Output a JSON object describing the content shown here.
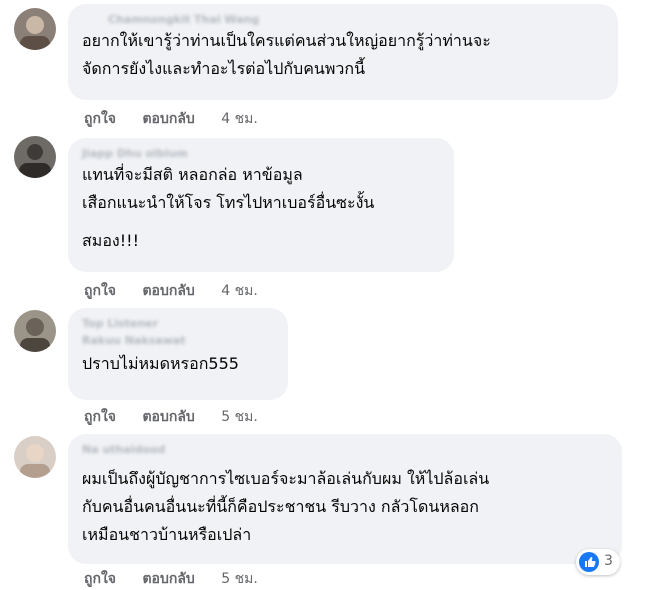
{
  "colors": {
    "bubble": "#f0f2f5",
    "text": "#050505",
    "meta": "#65676b",
    "like_blue": "#1877f2"
  },
  "comments": [
    {
      "author": "Chamnongkit Thai Wang",
      "text_lines": [
        "อยากให้เขารู้ว่าท่านเป็นใครแต่คนส่วนใหญ่อยากรู้ว่าท่านจะ",
        "จัดการยังไงและทำอะไรต่อไปกับคนพวกนี้"
      ],
      "like_label": "ถูกใจ",
      "reply_label": "ตอบกลับ",
      "time": "4 ชม."
    },
    {
      "author": "Jiapp Dhu olblum",
      "text_lines": [
        "แทนที่จะมีสติ หลอกล่อ หาข้อมูล",
        "เสือกแนะนำให้โจร โทรไปหาเบอร์อื่นซะงั้น",
        "สมอง!!!"
      ],
      "like_label": "ถูกใจ",
      "reply_label": "ตอบกลับ",
      "time": "4 ชม."
    },
    {
      "author": "Top Listener",
      "author_name": "Rakuu Naksawat",
      "text_lines": [
        "ปราบไม่หมดหรอก555"
      ],
      "like_label": "ถูกใจ",
      "reply_label": "ตอบกลับ",
      "time": "5 ชม."
    },
    {
      "author": "Na uthaidood",
      "text_lines": [
        "ผมเป็นถึงผู้บัญชาการไซเบอร์จะมาล้อเล่นกับผม ให้ไปล้อเล่น",
        "กับคนอื่นคนอื่นนะที่นี้ก็คือประชาชน รีบวาง กลัวโดนหลอก",
        "เหมือนชาวบ้านหรือเปล่า"
      ],
      "like_label": "ถูกใจ",
      "reply_label": "ตอบกลับ",
      "time": "5 ชม.",
      "reaction_count": "3",
      "reaction_icon": "thumbs-up-icon"
    }
  ]
}
